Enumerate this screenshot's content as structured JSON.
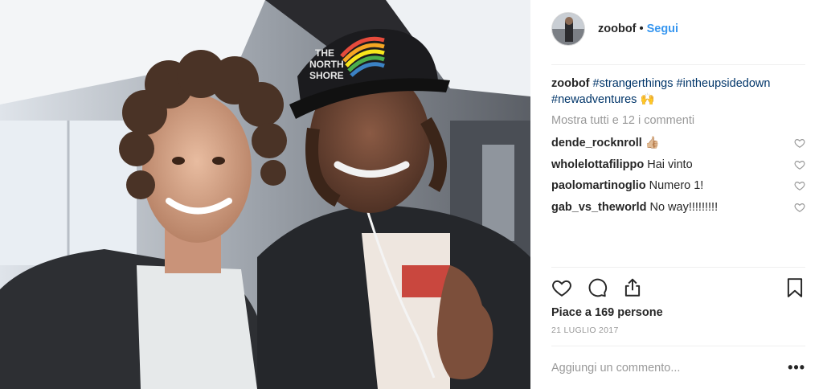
{
  "post": {
    "username": "zoobof",
    "separator": "•",
    "follow_label": "Segui",
    "caption": {
      "username": "zoobof",
      "tags": [
        "#strangerthings",
        "#intheupsidedown",
        "#newadventures"
      ],
      "emoji": "🙌"
    },
    "show_all_comments": "Mostra tutti e 12 i commenti",
    "comments": [
      {
        "username": "dende_rocknroll",
        "text": "👍🏼"
      },
      {
        "username": "wholelottafilippo",
        "text": "Hai vinto"
      },
      {
        "username": "paolomartinoglio",
        "text": "Numero 1!"
      },
      {
        "username": "gab_vs_theworld",
        "text": "No way!!!!!!!!!"
      }
    ],
    "likes": "Piace a 169 persone",
    "date": "21 LUGLIO 2017",
    "add_comment_placeholder": "Aggiungi un commento...",
    "more_options": "•••"
  },
  "photo": {
    "hat_text": [
      "THE",
      "NORTH",
      "SHORE"
    ]
  },
  "colors": {
    "link_blue": "#3897f0",
    "hashtag_blue": "#003569",
    "muted_gray": "#999999",
    "divider": "#efefef"
  },
  "icons": [
    "like-heart-icon",
    "comment-icon",
    "share-icon",
    "bookmark-icon",
    "comment-like-heart-icon"
  ]
}
